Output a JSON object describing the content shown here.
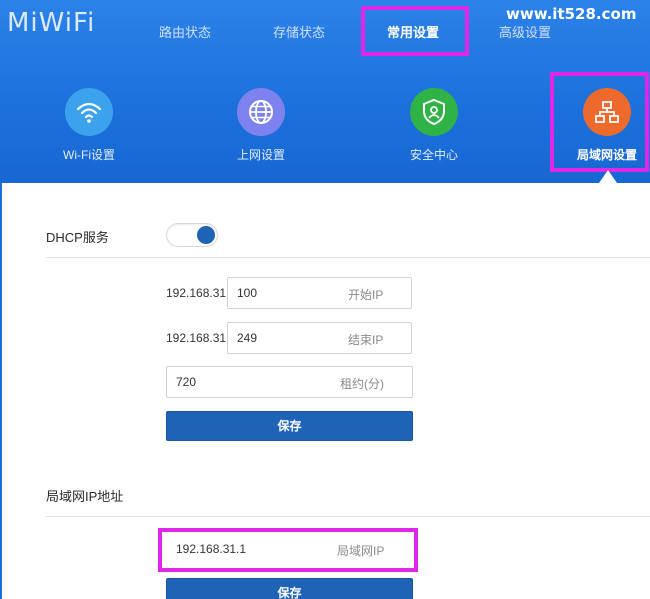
{
  "header": {
    "logo": "MiWiFi",
    "watermark": "www.it528.com",
    "nav": [
      {
        "label": "路由状态"
      },
      {
        "label": "存储状态"
      },
      {
        "label": "常用设置",
        "active": true
      },
      {
        "label": "高级设置"
      }
    ]
  },
  "tiles": [
    {
      "label": "Wi-Fi设置",
      "icon": "wifi-icon",
      "color": "#3ba3ee"
    },
    {
      "label": "上网设置",
      "icon": "globe-icon",
      "color": "#7d82ee"
    },
    {
      "label": "安全中心",
      "icon": "shield-icon",
      "color": "#2fb346"
    },
    {
      "label": "局域网设置",
      "icon": "network-icon",
      "color": "#ee6a2c",
      "active": true
    }
  ],
  "dhcp": {
    "title": "DHCP服务",
    "enabled": true,
    "ip_prefix": "192.168.31",
    "start_ip": {
      "value": "100",
      "hint": "开始IP"
    },
    "end_ip": {
      "value": "249",
      "hint": "结束IP"
    },
    "lease": {
      "value": "720",
      "hint": "租约(分)"
    },
    "save_label": "保存"
  },
  "lan": {
    "title": "局域网IP地址",
    "ip": {
      "value": "192.168.31.1",
      "hint": "局域网IP"
    },
    "save_label": "保存"
  },
  "colors": {
    "header_blue": "#1c70db",
    "button_blue": "#1f63b6",
    "highlight_magenta": "#e026e6"
  }
}
